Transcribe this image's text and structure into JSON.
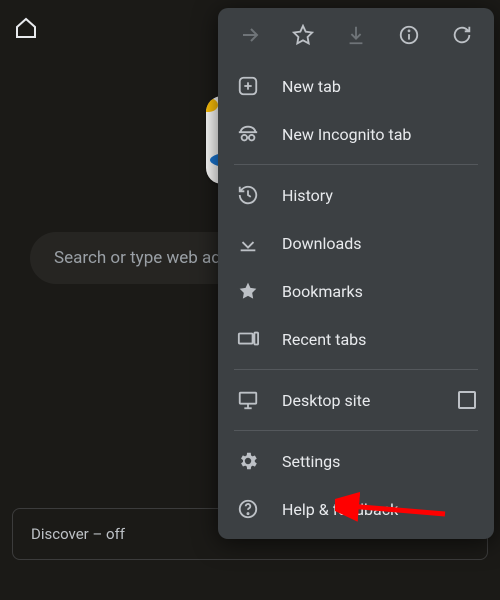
{
  "topbar": {},
  "search": {
    "placeholder": "Search or type web address"
  },
  "discover": {
    "label": "Discover – off"
  },
  "menu": {
    "items": {
      "new_tab": "New tab",
      "incognito": "New Incognito tab",
      "history": "History",
      "downloads": "Downloads",
      "bookmarks": "Bookmarks",
      "recent_tabs": "Recent tabs",
      "desktop_site": "Desktop site",
      "settings": "Settings",
      "help": "Help & feedback"
    }
  }
}
